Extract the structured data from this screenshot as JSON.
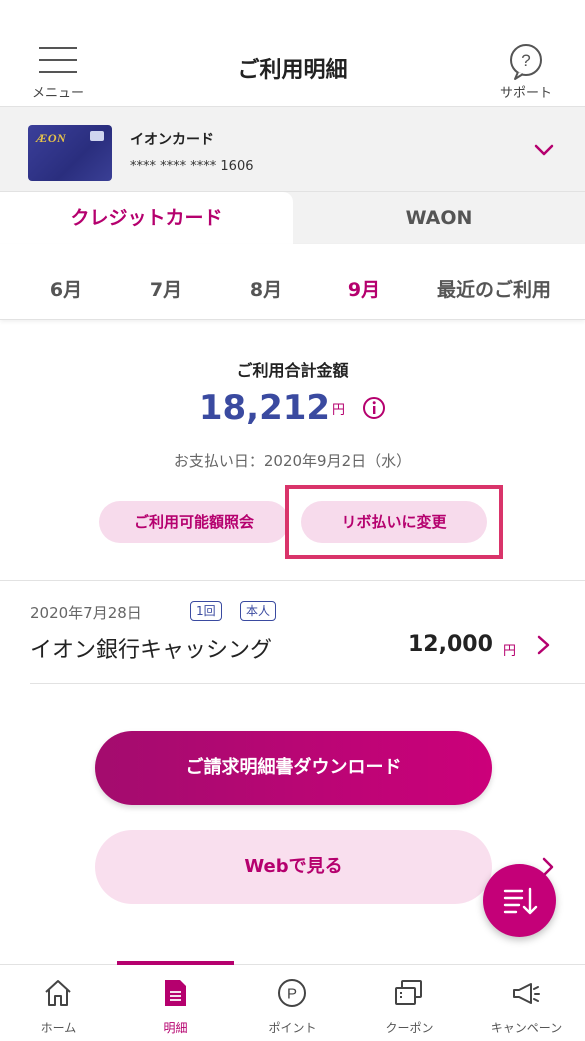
{
  "header": {
    "title": "ご利用明細",
    "menu_label": "メニュー",
    "support_label": "サポート"
  },
  "card": {
    "name": "イオンカード",
    "number": "**** **** **** 1606",
    "logo_text": "ÆON"
  },
  "tabs": [
    {
      "label": "クレジットカード",
      "active": true
    },
    {
      "label": "WAON",
      "active": false
    }
  ],
  "months": [
    {
      "label": "6月",
      "active": false
    },
    {
      "label": "7月",
      "active": false
    },
    {
      "label": "8月",
      "active": false
    },
    {
      "label": "9月",
      "active": true
    },
    {
      "label": "最近のご利用",
      "active": false
    }
  ],
  "summary": {
    "label": "ご利用合計金額",
    "amount": "18,212",
    "unit": "円",
    "payment_date": "お支払い日：2020年9月2日（水）",
    "limit_button": "ご利用可能額照会",
    "revo_button": "リボ払いに変更"
  },
  "transaction": {
    "date": "2020年7月28日",
    "badge_count": "1回",
    "badge_owner": "本人",
    "name": "イオン銀行キャッシング",
    "amount": "12,000",
    "unit": "円"
  },
  "buttons": {
    "download": "ご請求明細書ダウンロード",
    "web": "Webで見る"
  },
  "bottom_nav": [
    {
      "label": "ホーム",
      "icon": "home-icon",
      "active": false
    },
    {
      "label": "明細",
      "icon": "statement-icon",
      "active": true
    },
    {
      "label": "ポイント",
      "icon": "point-icon",
      "active": false
    },
    {
      "label": "クーポン",
      "icon": "coupon-icon",
      "active": false
    },
    {
      "label": "キャンペーン",
      "icon": "megaphone-icon",
      "active": false
    }
  ],
  "colors": {
    "accent": "#b5006e",
    "amount_blue": "#3a4aa0",
    "highlight_border": "#d9346a"
  }
}
